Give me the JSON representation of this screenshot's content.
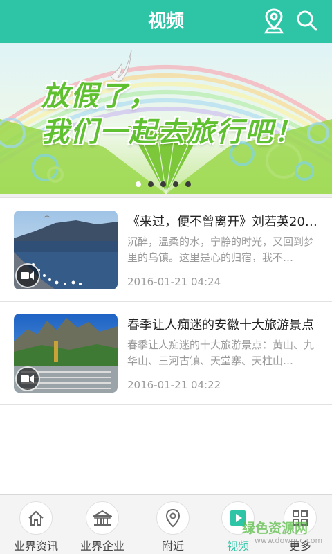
{
  "header": {
    "title": "视频"
  },
  "banner": {
    "line1": "放假了，",
    "line2": "我们一起去旅行吧！",
    "slide_count": 5,
    "active_slide": 1
  },
  "videos": [
    {
      "title": "《来过，便不曾离开》刘若英20…",
      "desc": "沉醉，温柔的水，宁静的时光，又回到梦里的乌镇。这里是心的归宿，我不…",
      "time": "2016-01-21 04:24"
    },
    {
      "title": "春季让人痴迷的安徽十大旅游景点",
      "desc": "春季让人痴迷的十大旅游景点：黄山、九华山、三河古镇、天堂寨、天柱山…",
      "time": "2016-01-21 04:22"
    }
  ],
  "nav": {
    "items": [
      {
        "label": "业界资讯",
        "icon": "home-icon"
      },
      {
        "label": "业界企业",
        "icon": "building-icon"
      },
      {
        "label": "附近",
        "icon": "location-pin-icon"
      },
      {
        "label": "视频",
        "icon": "play-icon"
      },
      {
        "label": "更多",
        "icon": "grid-icon"
      }
    ],
    "active_index": 3
  },
  "watermark": {
    "text": "绿色资源网",
    "sub": "www.downcc.com"
  },
  "colors": {
    "accent": "#2ec5a7",
    "banner_text": "#5fc030"
  }
}
